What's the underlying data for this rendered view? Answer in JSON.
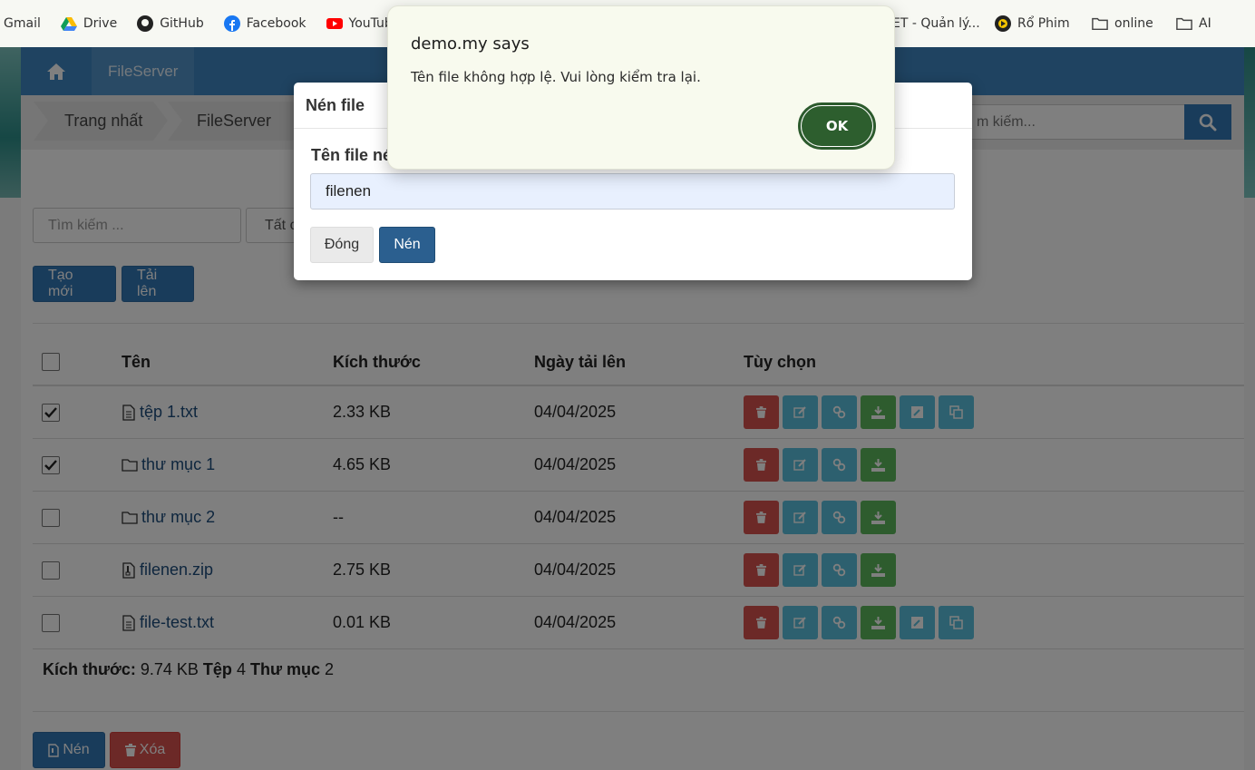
{
  "bookmarks": [
    {
      "label": "Gmail",
      "icon": "gmail-icon"
    },
    {
      "label": "Drive",
      "icon": "drive-icon"
    },
    {
      "label": "GitHub",
      "icon": "github-icon"
    },
    {
      "label": "Facebook",
      "icon": "facebook-icon"
    },
    {
      "label": "YouTub",
      "icon": "youtube-icon"
    },
    {
      "label": "ET - Quản lý...",
      "icon": ""
    },
    {
      "label": "Rổ Phim",
      "icon": "film-icon"
    },
    {
      "label": "online",
      "icon": "folder-icon"
    },
    {
      "label": "AI",
      "icon": "folder-icon"
    }
  ],
  "nav": {
    "brand": "FileServer"
  },
  "breadcrumbs": [
    "Trang nhất",
    "FileServer"
  ],
  "search": {
    "placeholder": "m kiếm..."
  },
  "filters": {
    "search_placeholder": "Tìm kiếm ...",
    "type_label": "Tất c"
  },
  "actions": {
    "create": "Tạo mới",
    "upload": "Tải lên"
  },
  "table": {
    "headers": {
      "name": "Tên",
      "size": "Kích thước",
      "date": "Ngày tải lên",
      "options": "Tùy chọn"
    },
    "rows": [
      {
        "name": "tệp 1.txt",
        "size": "2.33 KB",
        "date": "04/04/2025",
        "checked": true,
        "kind": "file"
      },
      {
        "name": "thư mục 1",
        "size": "4.65 KB",
        "date": "04/04/2025",
        "checked": true,
        "kind": "folder"
      },
      {
        "name": "thư mục 2",
        "size": "--",
        "date": "04/04/2025",
        "checked": false,
        "kind": "folder"
      },
      {
        "name": "filenen.zip",
        "size": "2.75 KB",
        "date": "04/04/2025",
        "checked": false,
        "kind": "zip"
      },
      {
        "name": "file-test.txt",
        "size": "0.01 KB",
        "date": "04/04/2025",
        "checked": false,
        "kind": "file"
      }
    ]
  },
  "summary": {
    "size_label": "Kích thước:",
    "size_value": "9.74 KB",
    "files_label": "Tệp",
    "files_value": "4",
    "folders_label": "Thư mục",
    "folders_value": "2"
  },
  "bottom": {
    "compress": "Nén",
    "delete": "Xóa"
  },
  "modal": {
    "title": "Nén file",
    "field_label": "Tên file né",
    "field_value": "filenen",
    "close": "Đóng",
    "submit": "Nén"
  },
  "alert": {
    "title": "demo.my says",
    "message": "Tên file không hợp lệ. Vui lòng kiểm tra lại.",
    "ok": "OK"
  }
}
